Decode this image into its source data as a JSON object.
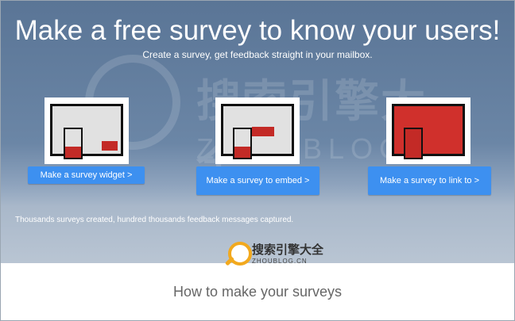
{
  "hero": {
    "title": "Make a free survey to know your users!",
    "subtitle": "Create a survey, get feedback straight in your mailbox.",
    "stats": "Thousands surveys created, hundred thousands feedback messages captured."
  },
  "options": [
    {
      "id": "widget",
      "button_label": "Make a survey widget >",
      "icon": "survey-widget-illustration"
    },
    {
      "id": "embed",
      "button_label": "Make a survey to embed >",
      "icon": "survey-embed-illustration"
    },
    {
      "id": "link",
      "button_label": "Make a survey to link to >",
      "icon": "survey-link-illustration"
    }
  ],
  "watermark": {
    "text": "搜索引擎大全",
    "subtext": "ZHOUBLOG.CN"
  },
  "logo": {
    "text": "搜索引擎大全",
    "subtext": "ZHOUBLOG.CN"
  },
  "section": {
    "title": "How to make your surveys"
  },
  "colors": {
    "hero_top": "#5a7596",
    "hero_bottom": "#b9c5d3",
    "button": "#3d90f0",
    "accent_red": "#c32a26",
    "logo_orange": "#f2a91e"
  }
}
